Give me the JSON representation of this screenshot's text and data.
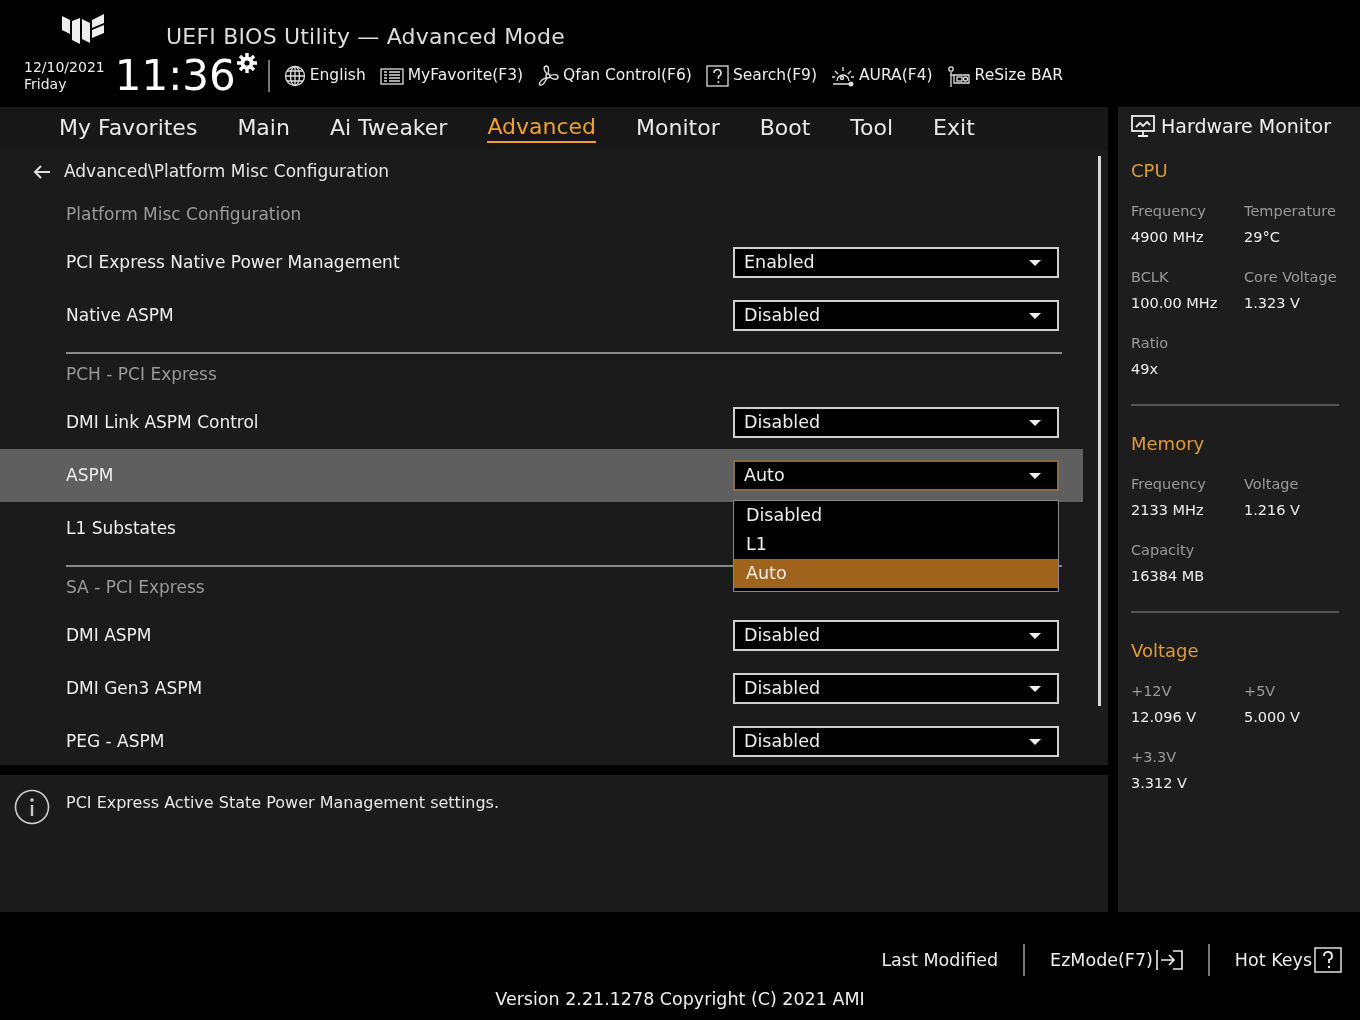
{
  "header": {
    "title": "UEFI BIOS Utility — Advanced Mode",
    "date": "12/10/2021",
    "day": "Friday",
    "time": "11:36",
    "toolbar": [
      {
        "label": "English",
        "kind": "globe"
      },
      {
        "label": "MyFavorite(F3)",
        "kind": "favorite"
      },
      {
        "label": "Qfan Control(F6)",
        "kind": "fan"
      },
      {
        "label": "Search(F9)",
        "kind": "search"
      },
      {
        "label": "AURA(F4)",
        "kind": "aura"
      },
      {
        "label": "ReSize BAR",
        "kind": "resizebar"
      }
    ]
  },
  "menu": [
    {
      "label": "My Favorites",
      "selected": false
    },
    {
      "label": "Main",
      "selected": false
    },
    {
      "label": "Ai Tweaker",
      "selected": false
    },
    {
      "label": "Advanced",
      "selected": true
    },
    {
      "label": "Monitor",
      "selected": false
    },
    {
      "label": "Boot",
      "selected": false
    },
    {
      "label": "Tool",
      "selected": false
    },
    {
      "label": "Exit",
      "selected": false
    }
  ],
  "settings": [
    {
      "kind": "breadcrumb",
      "text": "Advanced\\Platform Misc Configuration"
    },
    {
      "kind": "section",
      "text": "Platform Misc Configuration"
    },
    {
      "kind": "setting",
      "label": "PCI Express Native Power Management",
      "value": "Enabled",
      "selected": false,
      "expanded": false
    },
    {
      "kind": "setting",
      "label": "Native ASPM",
      "value": "Disabled",
      "selected": false,
      "expanded": false
    },
    {
      "kind": "divider"
    },
    {
      "kind": "section",
      "text": "PCH - PCI Express"
    },
    {
      "kind": "setting",
      "label": "DMI Link ASPM Control",
      "value": "Disabled",
      "selected": false,
      "expanded": false
    },
    {
      "kind": "setting",
      "label": "ASPM",
      "value": "Auto",
      "selected": true,
      "expanded": true,
      "options": [
        {
          "label": "Disabled",
          "selected": false
        },
        {
          "label": "L1",
          "selected": false
        },
        {
          "label": "Auto",
          "selected": true
        }
      ]
    },
    {
      "kind": "setting",
      "label": "L1 Substates",
      "selected": false
    },
    {
      "kind": "divider"
    },
    {
      "kind": "section",
      "text": "SA - PCI Express"
    },
    {
      "kind": "setting",
      "label": "DMI ASPM",
      "value": "Disabled",
      "selected": false,
      "expanded": false
    },
    {
      "kind": "setting",
      "label": "DMI Gen3 ASPM",
      "value": "Disabled",
      "selected": false,
      "expanded": false
    },
    {
      "kind": "setting",
      "label": "PEG - ASPM",
      "value": "Disabled",
      "selected": false,
      "expanded": false
    }
  ],
  "help": {
    "text": "PCI Express Active State Power Management settings."
  },
  "hardware_monitor": {
    "title": "Hardware Monitor",
    "groups": [
      {
        "title": "CPU",
        "items": [
          {
            "label": "Frequency",
            "value": "4900 MHz"
          },
          {
            "label": "Temperature",
            "value": "29°C"
          },
          {
            "label": "BCLK",
            "value": "100.00 MHz"
          },
          {
            "label": "Core Voltage",
            "value": "1.323 V"
          },
          {
            "label": "Ratio",
            "value": "49x"
          }
        ]
      },
      {
        "title": "Memory",
        "items": [
          {
            "label": "Frequency",
            "value": "2133 MHz"
          },
          {
            "label": "Voltage",
            "value": "1.216 V"
          },
          {
            "label": "Capacity",
            "value": "16384 MB"
          }
        ]
      },
      {
        "title": "Voltage",
        "items": [
          {
            "label": "+12V",
            "value": "12.096 V"
          },
          {
            "label": "+5V",
            "value": "5.000 V"
          },
          {
            "label": "+3.3V",
            "value": "3.312 V"
          }
        ]
      }
    ]
  },
  "footer": {
    "actions": [
      {
        "label": "Last Modified",
        "kind": "plain"
      },
      {
        "label": "EzMode(F7)",
        "kind": "exit"
      },
      {
        "label": "Hot Keys",
        "kind": "help"
      }
    ],
    "version": "Version 2.21.1278 Copyright (C) 2021 AMI"
  }
}
